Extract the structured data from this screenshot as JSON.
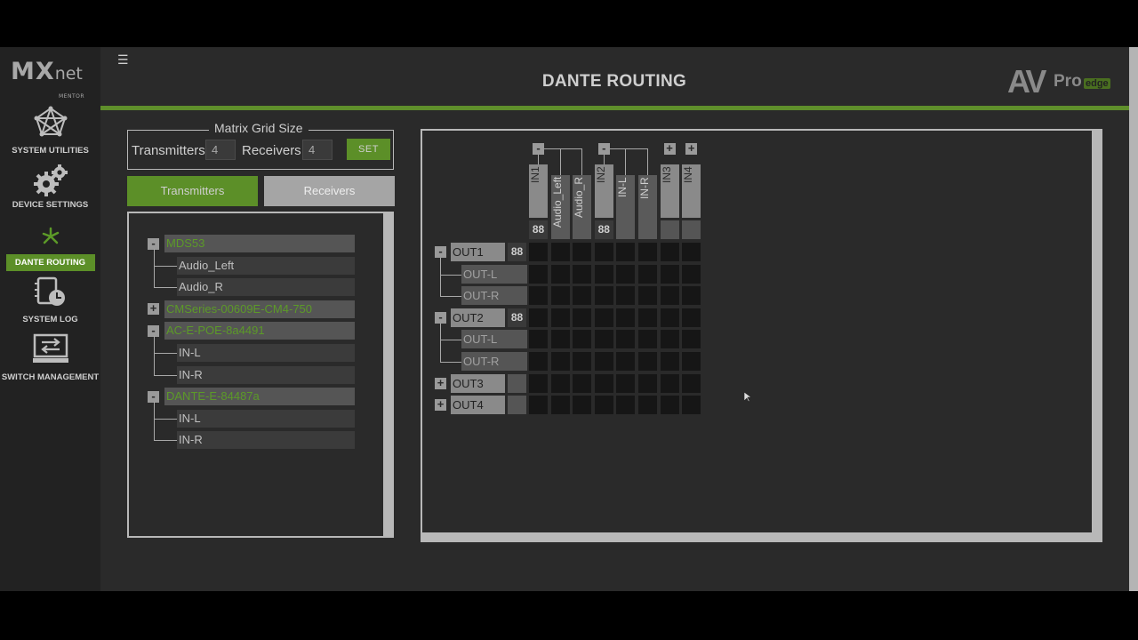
{
  "app": {
    "logo_main": "MX",
    "logo_sub": "net",
    "logo_tag": "MENTOR"
  },
  "brand": {
    "av": "AV",
    "pro": "Pro",
    "edge": "edge"
  },
  "page_title": "DANTE ROUTING",
  "menu_icon": "☰",
  "nav": [
    {
      "label": "SYSTEM UTILITIES",
      "icon": "network-icon"
    },
    {
      "label": "DEVICE SETTINGS",
      "icon": "gears-icon"
    },
    {
      "label": "DANTE ROUTING",
      "icon": "dante-icon",
      "active": true
    },
    {
      "label": "SYSTEM LOG",
      "icon": "log-icon"
    },
    {
      "label": "SWITCH MANAGEMENT",
      "icon": "switch-icon"
    }
  ],
  "grid_size": {
    "title": "Matrix Grid Size",
    "transmitters_label": "Transmitters",
    "transmitters_value": "4",
    "receivers_label": "Receivers",
    "receivers_value": "4",
    "set_label": "SET"
  },
  "tabs": {
    "transmitters": "Transmitters",
    "receivers": "Receivers"
  },
  "tree": [
    {
      "label": "MDS53",
      "expanded": true,
      "children": [
        "Audio_Left",
        "Audio_R"
      ]
    },
    {
      "label": "CMSeries-00609E-CM4-750",
      "expanded": false,
      "children": []
    },
    {
      "label": "AC-E-POE-8a4491",
      "expanded": true,
      "children": [
        "IN-L",
        "IN-R"
      ]
    },
    {
      "label": "DANTE-E-84487a",
      "expanded": true,
      "children": [
        "IN-L",
        "IN-R"
      ]
    }
  ],
  "matrix": {
    "columns": [
      {
        "label": "IN1",
        "type": "main"
      },
      {
        "label": "Audio_Left",
        "type": "sub"
      },
      {
        "label": "Audio_R",
        "type": "sub"
      },
      {
        "label": "IN2",
        "type": "main"
      },
      {
        "label": "IN-L",
        "type": "sub"
      },
      {
        "label": "IN-R",
        "type": "sub"
      },
      {
        "label": "IN3",
        "type": "main"
      },
      {
        "label": "IN4",
        "type": "main"
      }
    ],
    "rows": [
      {
        "label": "OUT1",
        "type": "main"
      },
      {
        "label": "OUT-L",
        "type": "sub"
      },
      {
        "label": "OUT-R",
        "type": "sub"
      },
      {
        "label": "OUT2",
        "type": "main"
      },
      {
        "label": "OUT-L",
        "type": "sub"
      },
      {
        "label": "OUT-R",
        "type": "sub"
      },
      {
        "label": "OUT3",
        "type": "main"
      },
      {
        "label": "OUT4",
        "type": "main"
      }
    ],
    "collapse_symbol": "-",
    "expand_symbol": "+",
    "split_symbol": "88"
  }
}
